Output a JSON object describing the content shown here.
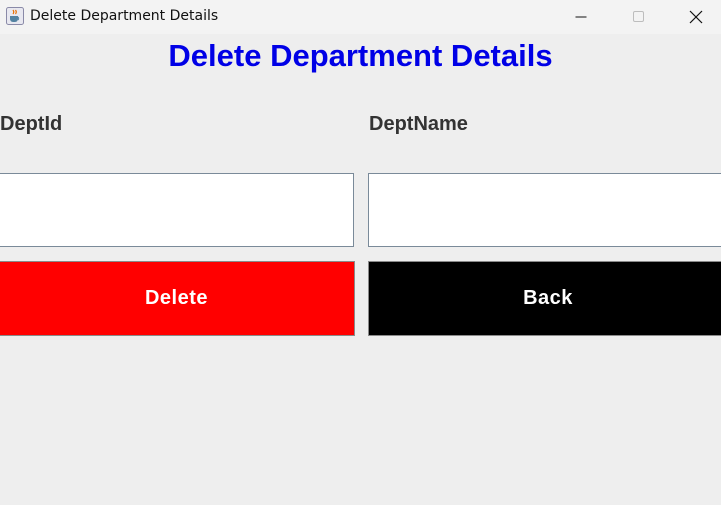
{
  "window": {
    "title": "Delete Department Details",
    "icon": "java-coffee-cup-icon",
    "controls": [
      "minimize-icon",
      "maximize-icon",
      "close-icon"
    ]
  },
  "form": {
    "heading": "Delete Department Details",
    "dept_id_label": "DeptId",
    "dept_name_label": "DeptName",
    "dept_id_value": "",
    "dept_name_value": "",
    "delete_label": "Delete",
    "back_label": "Back"
  },
  "colors": {
    "heading": "#0000e6",
    "delete_button": "#ff0000",
    "back_button": "#000000",
    "button_text": "#ffffff",
    "label_text": "#333333",
    "background": "#eeeeee"
  }
}
